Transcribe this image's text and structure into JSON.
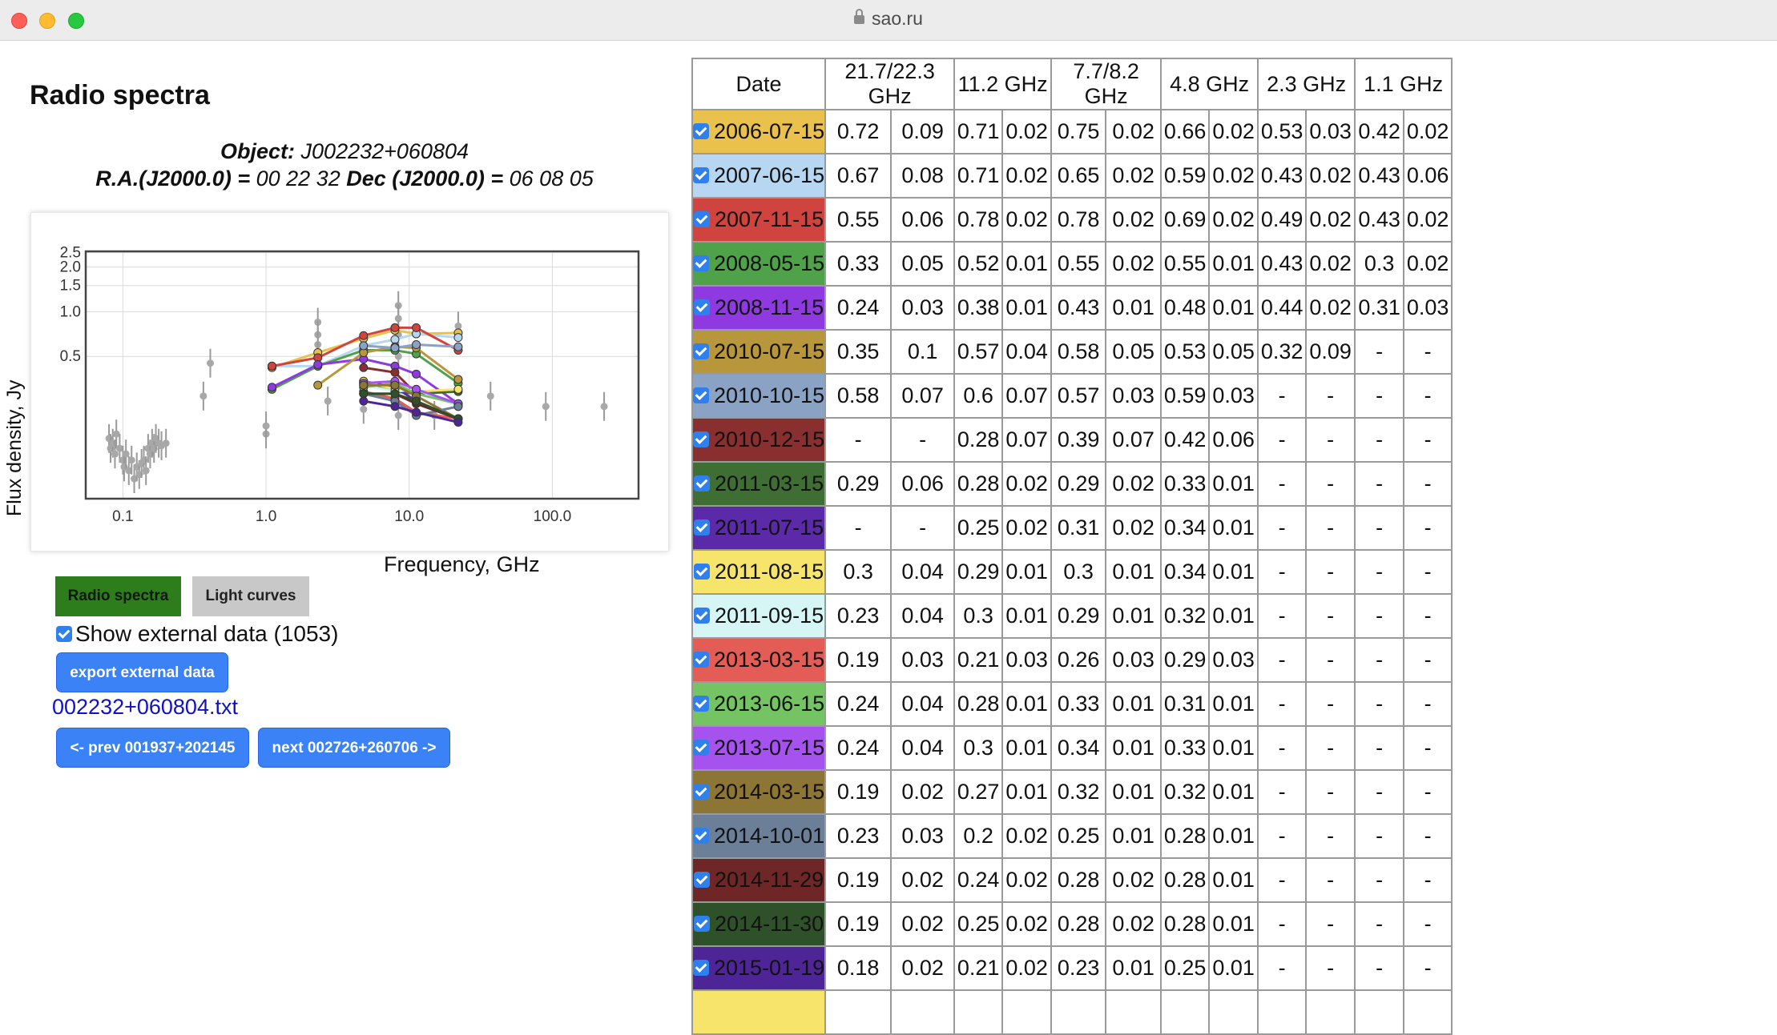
{
  "browser": {
    "url": "sao.ru"
  },
  "page": {
    "heading": "Radio spectra",
    "object_label": "Object:",
    "object_value": "J002232+060804",
    "ra_label": "R.A.(J2000.0) =",
    "ra_value": "00 22 32",
    "dec_label": "Dec (J2000.0) =",
    "dec_value": "06 08 05"
  },
  "controls": {
    "tab_spectra": "Radio spectra",
    "tab_light_curves": "Light curves",
    "show_external_label": "Show external data (1053)",
    "export_button": "export external data",
    "file_link": "002232+060804.txt",
    "prev_button": "<- prev 001937+202145",
    "next_button": "next 002726+260706 ->"
  },
  "chart_data": {
    "type": "scatter",
    "xlabel": "Frequency, GHz",
    "ylabel": "Flux density, Jy",
    "x_scale": "log",
    "y_scale": "log",
    "xlim": [
      0.055,
      400
    ],
    "ylim": [
      0.055,
      2.55
    ],
    "x_ticks": [
      0.1,
      1.0,
      10.0,
      100.0
    ],
    "x_tick_labels": [
      "0.1",
      "1.0",
      "10.0",
      "100.0"
    ],
    "y_ticks": [
      0.5,
      1.0,
      1.5,
      2.0,
      2.5
    ],
    "y_tick_labels": [
      "0.5",
      "1.0",
      "1.5",
      "2.0",
      "2.5"
    ],
    "grid": true,
    "external_points": [
      {
        "x": 0.08,
        "y": 0.14
      },
      {
        "x": 0.082,
        "y": 0.12
      },
      {
        "x": 0.085,
        "y": 0.13
      },
      {
        "x": 0.088,
        "y": 0.11
      },
      {
        "x": 0.09,
        "y": 0.15
      },
      {
        "x": 0.095,
        "y": 0.12
      },
      {
        "x": 0.1,
        "y": 0.1
      },
      {
        "x": 0.102,
        "y": 0.09
      },
      {
        "x": 0.105,
        "y": 0.11
      },
      {
        "x": 0.11,
        "y": 0.085
      },
      {
        "x": 0.115,
        "y": 0.1
      },
      {
        "x": 0.12,
        "y": 0.075
      },
      {
        "x": 0.125,
        "y": 0.09
      },
      {
        "x": 0.13,
        "y": 0.08
      },
      {
        "x": 0.135,
        "y": 0.095
      },
      {
        "x": 0.14,
        "y": 0.1
      },
      {
        "x": 0.145,
        "y": 0.085
      },
      {
        "x": 0.15,
        "y": 0.12
      },
      {
        "x": 0.155,
        "y": 0.11
      },
      {
        "x": 0.16,
        "y": 0.13
      },
      {
        "x": 0.165,
        "y": 0.12
      },
      {
        "x": 0.17,
        "y": 0.14
      },
      {
        "x": 0.178,
        "y": 0.13
      },
      {
        "x": 0.186,
        "y": 0.125
      },
      {
        "x": 0.2,
        "y": 0.13
      },
      {
        "x": 0.365,
        "y": 0.27
      },
      {
        "x": 0.408,
        "y": 0.45
      },
      {
        "x": 1.0,
        "y": 0.15
      },
      {
        "x": 1.0,
        "y": 0.17
      },
      {
        "x": 2.3,
        "y": 0.85
      },
      {
        "x": 2.3,
        "y": 0.7
      },
      {
        "x": 2.3,
        "y": 0.6
      },
      {
        "x": 2.3,
        "y": 0.5
      },
      {
        "x": 2.7,
        "y": 0.25
      },
      {
        "x": 4.8,
        "y": 0.22
      },
      {
        "x": 8.4,
        "y": 1.1
      },
      {
        "x": 8.4,
        "y": 0.9
      },
      {
        "x": 8.4,
        "y": 0.7
      },
      {
        "x": 8.4,
        "y": 0.5
      },
      {
        "x": 8.4,
        "y": 0.2
      },
      {
        "x": 15.0,
        "y": 0.2
      },
      {
        "x": 22.0,
        "y": 0.8
      },
      {
        "x": 37.0,
        "y": 0.27
      },
      {
        "x": 90.0,
        "y": 0.23
      },
      {
        "x": 230.0,
        "y": 0.23
      }
    ],
    "series": [
      {
        "name": "2006-07-15",
        "color": "#e9c14c",
        "x": [
          1.1,
          2.3,
          4.8,
          7.95,
          11.2,
          22.0
        ],
        "y": [
          0.42,
          0.53,
          0.66,
          0.75,
          0.71,
          0.72
        ]
      },
      {
        "name": "2007-06-15",
        "color": "#b7d6f2",
        "x": [
          1.1,
          2.3,
          4.8,
          7.95,
          11.2,
          22.0
        ],
        "y": [
          0.43,
          0.43,
          0.59,
          0.65,
          0.71,
          0.67
        ]
      },
      {
        "name": "2007-11-15",
        "color": "#d0443f",
        "x": [
          1.1,
          2.3,
          4.8,
          7.95,
          11.2,
          22.0
        ],
        "y": [
          0.43,
          0.49,
          0.69,
          0.78,
          0.78,
          0.55
        ]
      },
      {
        "name": "2008-05-15",
        "color": "#4fa24a",
        "x": [
          1.1,
          2.3,
          4.8,
          7.95,
          11.2,
          22.0
        ],
        "y": [
          0.3,
          0.43,
          0.55,
          0.55,
          0.52,
          0.33
        ]
      },
      {
        "name": "2008-11-15",
        "color": "#8e3ae0",
        "x": [
          1.1,
          2.3,
          4.8,
          7.95,
          11.2,
          22.0
        ],
        "y": [
          0.31,
          0.44,
          0.48,
          0.43,
          0.38,
          0.24
        ]
      },
      {
        "name": "2010-07-15",
        "color": "#b8963c",
        "x": [
          2.3,
          4.8,
          7.95,
          11.2,
          22.0
        ],
        "y": [
          0.32,
          0.53,
          0.58,
          0.57,
          0.35
        ]
      },
      {
        "name": "2010-10-15",
        "color": "#8aa2c4",
        "x": [
          4.8,
          7.95,
          11.2,
          22.0
        ],
        "y": [
          0.59,
          0.57,
          0.6,
          0.58
        ]
      },
      {
        "name": "2010-12-15",
        "color": "#8a2f2f",
        "x": [
          4.8,
          7.95,
          11.2
        ],
        "y": [
          0.42,
          0.39,
          0.28
        ]
      },
      {
        "name": "2011-03-15",
        "color": "#3f6e35",
        "x": [
          4.8,
          7.95,
          11.2,
          22.0
        ],
        "y": [
          0.33,
          0.29,
          0.28,
          0.29
        ]
      },
      {
        "name": "2011-07-15",
        "color": "#5a2aa8",
        "x": [
          4.8,
          7.95,
          11.2
        ],
        "y": [
          0.34,
          0.31,
          0.25
        ]
      },
      {
        "name": "2011-08-15",
        "color": "#f7e46a",
        "x": [
          4.8,
          7.95,
          11.2,
          22.0
        ],
        "y": [
          0.34,
          0.3,
          0.29,
          0.3
        ]
      },
      {
        "name": "2011-09-15",
        "color": "#d6f6f6",
        "x": [
          4.8,
          7.95,
          11.2,
          22.0
        ],
        "y": [
          0.32,
          0.29,
          0.3,
          0.23
        ]
      },
      {
        "name": "2013-03-15",
        "color": "#e35c56",
        "x": [
          4.8,
          7.95,
          11.2,
          22.0
        ],
        "y": [
          0.29,
          0.26,
          0.21,
          0.19
        ]
      },
      {
        "name": "2013-06-15",
        "color": "#74c463",
        "x": [
          4.8,
          7.95,
          11.2,
          22.0
        ],
        "y": [
          0.31,
          0.33,
          0.28,
          0.24
        ]
      },
      {
        "name": "2013-07-15",
        "color": "#a652ee",
        "x": [
          4.8,
          7.95,
          11.2,
          22.0
        ],
        "y": [
          0.33,
          0.34,
          0.3,
          0.24
        ]
      },
      {
        "name": "2014-03-15",
        "color": "#8d7536",
        "x": [
          4.8,
          7.95,
          11.2,
          22.0
        ],
        "y": [
          0.32,
          0.32,
          0.27,
          0.19
        ]
      },
      {
        "name": "2014-10-01",
        "color": "#6b7f98",
        "x": [
          4.8,
          7.95,
          11.2,
          22.0
        ],
        "y": [
          0.28,
          0.25,
          0.2,
          0.23
        ]
      },
      {
        "name": "2014-11-29",
        "color": "#6e2626",
        "x": [
          4.8,
          7.95,
          11.2,
          22.0
        ],
        "y": [
          0.28,
          0.28,
          0.24,
          0.19
        ]
      },
      {
        "name": "2014-11-30",
        "color": "#2f5129",
        "x": [
          4.8,
          7.95,
          11.2,
          22.0
        ],
        "y": [
          0.28,
          0.28,
          0.25,
          0.19
        ]
      },
      {
        "name": "2015-01-19",
        "color": "#4e2596",
        "x": [
          4.8,
          7.95,
          11.2,
          22.0
        ],
        "y": [
          0.25,
          0.23,
          0.21,
          0.18
        ]
      }
    ]
  },
  "table": {
    "headers": [
      {
        "label": "Date",
        "colspan": 1
      },
      {
        "label": "21.7/22.3 GHz",
        "colspan": 2
      },
      {
        "label": "11.2 GHz",
        "colspan": 2
      },
      {
        "label": "7.7/8.2 GHz",
        "colspan": 2
      },
      {
        "label": "4.8 GHz",
        "colspan": 2
      },
      {
        "label": "2.3 GHz",
        "colspan": 2
      },
      {
        "label": "1.1 GHz",
        "colspan": 2
      }
    ],
    "rows": [
      {
        "date": "2006-07-15",
        "color": "#e9c14c",
        "values": [
          "0.72",
          "0.09",
          "0.71",
          "0.02",
          "0.75",
          "0.02",
          "0.66",
          "0.02",
          "0.53",
          "0.03",
          "0.42",
          "0.02"
        ]
      },
      {
        "date": "2007-06-15",
        "color": "#b7d6f2",
        "values": [
          "0.67",
          "0.08",
          "0.71",
          "0.02",
          "0.65",
          "0.02",
          "0.59",
          "0.02",
          "0.43",
          "0.02",
          "0.43",
          "0.06"
        ]
      },
      {
        "date": "2007-11-15",
        "color": "#d0443f",
        "values": [
          "0.55",
          "0.06",
          "0.78",
          "0.02",
          "0.78",
          "0.02",
          "0.69",
          "0.02",
          "0.49",
          "0.02",
          "0.43",
          "0.02"
        ]
      },
      {
        "date": "2008-05-15",
        "color": "#4fa24a",
        "values": [
          "0.33",
          "0.05",
          "0.52",
          "0.01",
          "0.55",
          "0.02",
          "0.55",
          "0.01",
          "0.43",
          "0.02",
          "0.3",
          "0.02"
        ]
      },
      {
        "date": "2008-11-15",
        "color": "#8e3ae0",
        "values": [
          "0.24",
          "0.03",
          "0.38",
          "0.01",
          "0.43",
          "0.01",
          "0.48",
          "0.01",
          "0.44",
          "0.02",
          "0.31",
          "0.03"
        ]
      },
      {
        "date": "2010-07-15",
        "color": "#b8963c",
        "values": [
          "0.35",
          "0.1",
          "0.57",
          "0.04",
          "0.58",
          "0.05",
          "0.53",
          "0.05",
          "0.32",
          "0.09",
          "-",
          "-"
        ]
      },
      {
        "date": "2010-10-15",
        "color": "#8aa2c4",
        "values": [
          "0.58",
          "0.07",
          "0.6",
          "0.07",
          "0.57",
          "0.03",
          "0.59",
          "0.03",
          "-",
          "-",
          "-",
          "-"
        ]
      },
      {
        "date": "2010-12-15",
        "color": "#8a2f2f",
        "values": [
          "-",
          "-",
          "0.28",
          "0.07",
          "0.39",
          "0.07",
          "0.42",
          "0.06",
          "-",
          "-",
          "-",
          "-"
        ]
      },
      {
        "date": "2011-03-15",
        "color": "#3f6e35",
        "values": [
          "0.29",
          "0.06",
          "0.28",
          "0.02",
          "0.29",
          "0.02",
          "0.33",
          "0.01",
          "-",
          "-",
          "-",
          "-"
        ]
      },
      {
        "date": "2011-07-15",
        "color": "#5a2aa8",
        "values": [
          "-",
          "-",
          "0.25",
          "0.02",
          "0.31",
          "0.02",
          "0.34",
          "0.01",
          "-",
          "-",
          "-",
          "-"
        ]
      },
      {
        "date": "2011-08-15",
        "color": "#f7e46a",
        "values": [
          "0.3",
          "0.04",
          "0.29",
          "0.01",
          "0.3",
          "0.01",
          "0.34",
          "0.01",
          "-",
          "-",
          "-",
          "-"
        ]
      },
      {
        "date": "2011-09-15",
        "color": "#d6f6f6",
        "values": [
          "0.23",
          "0.04",
          "0.3",
          "0.01",
          "0.29",
          "0.01",
          "0.32",
          "0.01",
          "-",
          "-",
          "-",
          "-"
        ]
      },
      {
        "date": "2013-03-15",
        "color": "#e35c56",
        "values": [
          "0.19",
          "0.03",
          "0.21",
          "0.03",
          "0.26",
          "0.03",
          "0.29",
          "0.03",
          "-",
          "-",
          "-",
          "-"
        ]
      },
      {
        "date": "2013-06-15",
        "color": "#74c463",
        "values": [
          "0.24",
          "0.04",
          "0.28",
          "0.01",
          "0.33",
          "0.01",
          "0.31",
          "0.01",
          "-",
          "-",
          "-",
          "-"
        ]
      },
      {
        "date": "2013-07-15",
        "color": "#a652ee",
        "values": [
          "0.24",
          "0.04",
          "0.3",
          "0.01",
          "0.34",
          "0.01",
          "0.33",
          "0.01",
          "-",
          "-",
          "-",
          "-"
        ]
      },
      {
        "date": "2014-03-15",
        "color": "#8d7536",
        "values": [
          "0.19",
          "0.02",
          "0.27",
          "0.01",
          "0.32",
          "0.01",
          "0.32",
          "0.01",
          "-",
          "-",
          "-",
          "-"
        ]
      },
      {
        "date": "2014-10-01",
        "color": "#6b7f98",
        "values": [
          "0.23",
          "0.03",
          "0.2",
          "0.02",
          "0.25",
          "0.01",
          "0.28",
          "0.01",
          "-",
          "-",
          "-",
          "-"
        ]
      },
      {
        "date": "2014-11-29",
        "color": "#6e2626",
        "values": [
          "0.19",
          "0.02",
          "0.24",
          "0.02",
          "0.28",
          "0.02",
          "0.28",
          "0.01",
          "-",
          "-",
          "-",
          "-"
        ]
      },
      {
        "date": "2014-11-30",
        "color": "#2f5129",
        "values": [
          "0.19",
          "0.02",
          "0.25",
          "0.02",
          "0.28",
          "0.02",
          "0.28",
          "0.01",
          "-",
          "-",
          "-",
          "-"
        ]
      },
      {
        "date": "2015-01-19",
        "color": "#4e2596",
        "values": [
          "0.18",
          "0.02",
          "0.21",
          "0.02",
          "0.23",
          "0.01",
          "0.25",
          "0.01",
          "-",
          "-",
          "-",
          "-"
        ]
      },
      {
        "date": "",
        "color": "#f7e46a",
        "values": [
          "",
          "",
          "",
          "",
          "",
          "",
          "",
          "",
          "",
          "",
          "",
          ""
        ]
      }
    ]
  }
}
